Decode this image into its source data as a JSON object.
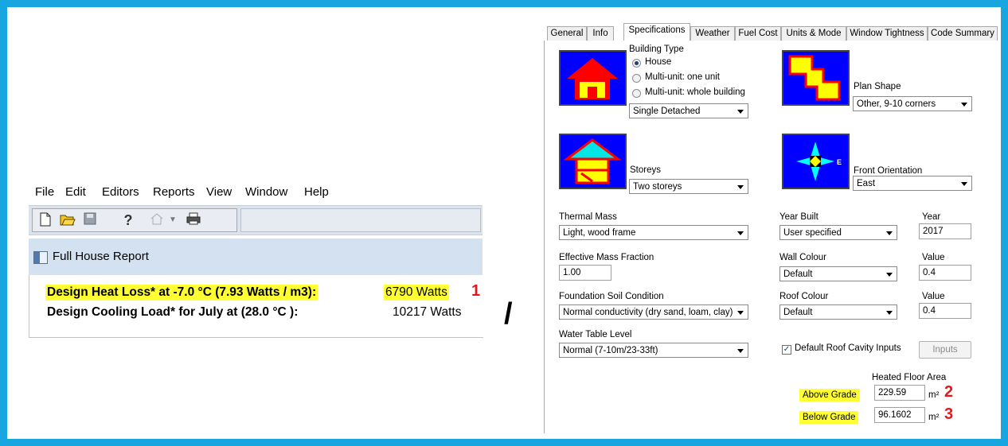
{
  "left": {
    "menu": [
      "File",
      "Edit",
      "Editors",
      "Reports",
      "View",
      "Window",
      "Help"
    ],
    "report_title": "Full House Report",
    "rows": [
      {
        "label": "Design Heat Loss* at -7.0 °C (7.93 Watts / m3):",
        "value": "6790 Watts",
        "marker": "1"
      },
      {
        "label": "Design Cooling Load* for July at (28.0 °C ):",
        "value": "10217 Watts"
      }
    ]
  },
  "separator": "/",
  "dialog": {
    "tabs": [
      "General",
      "Info",
      "Specifications",
      "Weather",
      "Fuel Cost",
      "Units & Mode",
      "Window Tightness",
      "Code Summary"
    ],
    "active_tab": "Specifications",
    "building_type": {
      "label": "Building Type",
      "options": [
        "House",
        "Multi-unit: one unit",
        "Multi-unit: whole building"
      ],
      "selected": "House",
      "subtype": "Single Detached"
    },
    "plan_shape": {
      "label": "Plan Shape",
      "value": "Other, 9-10 corners"
    },
    "storeys": {
      "label": "Storeys",
      "value": "Two storeys"
    },
    "front_orientation": {
      "label": "Front Orientation",
      "value": "East",
      "compass_letter": "E"
    },
    "thermal_mass": {
      "label": "Thermal Mass",
      "value": "Light, wood frame"
    },
    "year_built": {
      "label": "Year Built",
      "value": "User specified",
      "year_label": "Year",
      "year": "2017"
    },
    "effective_mass": {
      "label": "Effective Mass Fraction",
      "value": "1.00"
    },
    "wall_colour": {
      "label": "Wall Colour",
      "value": "Default",
      "value_label": "Value",
      "number": "0.4"
    },
    "foundation_soil": {
      "label": "Foundation Soil Condition",
      "value": "Normal conductivity (dry sand, loam, clay)"
    },
    "roof_colour": {
      "label": "Roof Colour",
      "value": "Default",
      "value_label": "Value",
      "number": "0.4"
    },
    "water_table": {
      "label": "Water Table Level",
      "value": "Normal (7-10m/23-33ft)"
    },
    "roof_cavity": {
      "label": "Default Roof Cavity Inputs",
      "checked": true,
      "button": "Inputs"
    },
    "heated_floor_area": {
      "title": "Heated Floor Area",
      "above_label": "Above Grade",
      "above_value": "229.59",
      "above_unit": "m²",
      "above_marker": "2",
      "below_label": "Below Grade",
      "below_value": "96.1602",
      "below_unit": "m²",
      "below_marker": "3"
    }
  },
  "colors": {
    "frame": "#17a6e0",
    "highlight": "#ffff33",
    "marker_red": "#e8161b",
    "icon_blue": "#0000ff"
  }
}
